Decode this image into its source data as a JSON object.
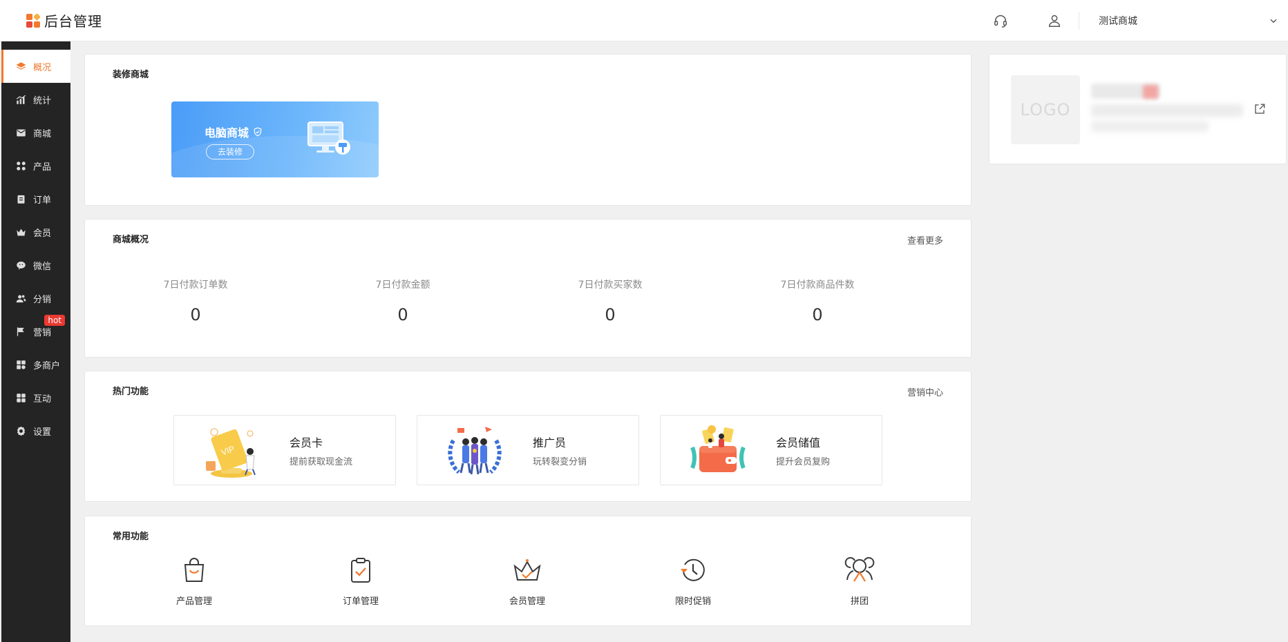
{
  "header": {
    "brand_title": "后台管理",
    "store_selector": "测试商城",
    "icons": [
      "headset-icon",
      "user-icon",
      "chevron-down-icon"
    ]
  },
  "sidebar": {
    "active_color": "#f07a2e",
    "items": [
      {
        "label": "概况",
        "icon": "layers-icon",
        "active": true
      },
      {
        "label": "统计",
        "icon": "chart-icon"
      },
      {
        "label": "商城",
        "icon": "mail-icon"
      },
      {
        "label": "产品",
        "icon": "grid-icon"
      },
      {
        "label": "订单",
        "icon": "clipboard-icon"
      },
      {
        "label": "会员",
        "icon": "crown-icon"
      },
      {
        "label": "微信",
        "icon": "wechat-icon"
      },
      {
        "label": "分销",
        "icon": "users-icon"
      },
      {
        "label": "营销",
        "icon": "flag-icon",
        "badge": "hot"
      },
      {
        "label": "多商户",
        "icon": "store-icon"
      },
      {
        "label": "互动",
        "icon": "apps-icon"
      },
      {
        "label": "设置",
        "icon": "gear-icon"
      }
    ]
  },
  "decorate": {
    "title": "装修商城",
    "banner_title": "电脑商城",
    "banner_button": "去装修"
  },
  "overview": {
    "title": "商城概况",
    "more_link": "查看更多",
    "stats": [
      {
        "label": "7日付款订单数",
        "value": "0"
      },
      {
        "label": "7日付款金额",
        "value": "0"
      },
      {
        "label": "7日付款买家数",
        "value": "0"
      },
      {
        "label": "7日付款商品件数",
        "value": "0"
      }
    ]
  },
  "hot_features": {
    "title": "热门功能",
    "link": "营销中心",
    "items": [
      {
        "name": "会员卡",
        "desc": "提前获取现金流"
      },
      {
        "name": "推广员",
        "desc": "玩转裂变分销"
      },
      {
        "name": "会员储值",
        "desc": "提升会员复购"
      }
    ]
  },
  "common_features": {
    "title": "常用功能",
    "items": [
      {
        "label": "产品管理",
        "icon": "shopping-bag-icon"
      },
      {
        "label": "订单管理",
        "icon": "clipboard-check-icon"
      },
      {
        "label": "会员管理",
        "icon": "crown-icon"
      },
      {
        "label": "限时促销",
        "icon": "clock-icon"
      },
      {
        "label": "拼团",
        "icon": "group-icon"
      }
    ]
  },
  "store_card": {
    "logo_text": "LOGO"
  }
}
